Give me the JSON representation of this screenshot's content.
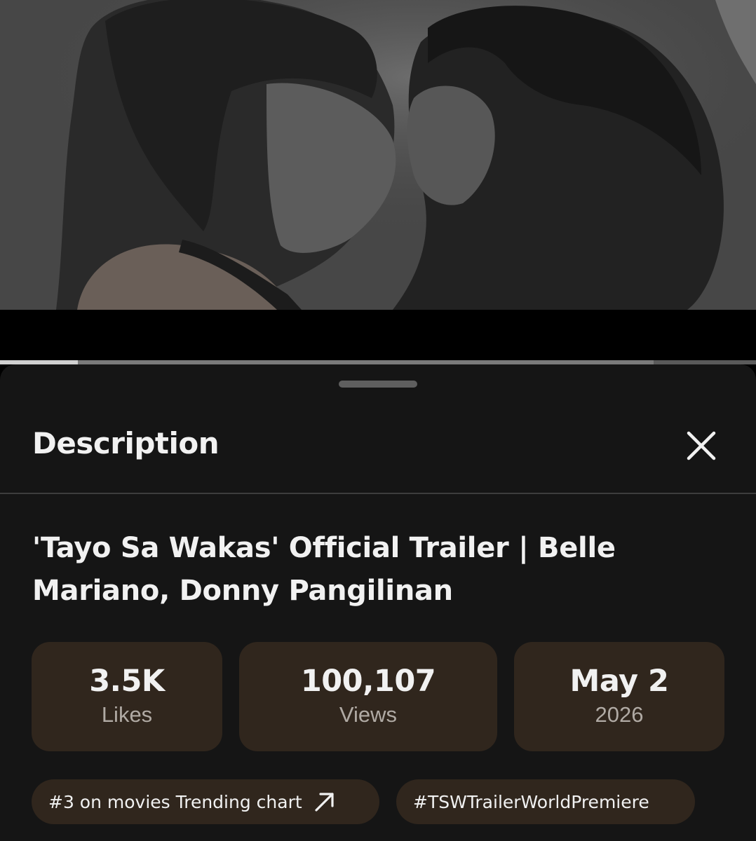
{
  "player": {
    "progress_played": 0.103,
    "progress_buffered": 0.865
  },
  "sheet": {
    "title": "Description",
    "close_icon": "close-icon"
  },
  "video": {
    "title": "'Tayo Sa Wakas' Official Trailer | Belle Mariano, Donny Pangilinan"
  },
  "stats": [
    {
      "value": "3.5K",
      "label": "Likes"
    },
    {
      "value": "100,107",
      "label": "Views"
    },
    {
      "value": "May 2",
      "label": "2026"
    }
  ],
  "chips": [
    {
      "label": "#3 on movies Trending chart",
      "icon": "arrow-up-right-icon"
    },
    {
      "label": "#TSWTrailerWorldPremiere"
    }
  ],
  "colors": {
    "sheet_bg": "#151515",
    "card_bg": "#30261d",
    "text_primary": "#f1f1f1",
    "text_secondary": "#b0aaa4"
  }
}
